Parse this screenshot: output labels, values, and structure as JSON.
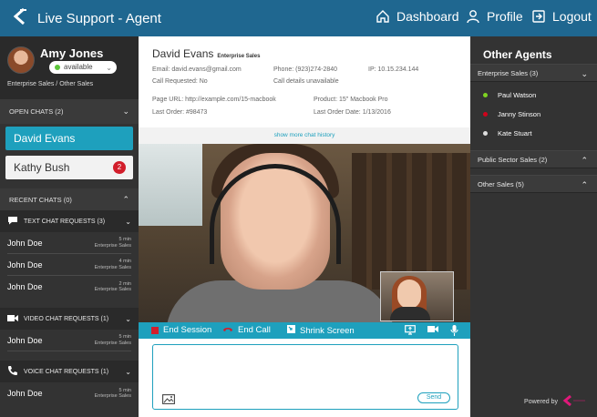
{
  "app": {
    "title": "Live Support - Agent"
  },
  "nav": {
    "dashboard": "Dashboard",
    "profile": "Profile",
    "logout": "Logout"
  },
  "agent": {
    "name": "Amy Jones",
    "status": "available",
    "team": "Enterprise Sales / Other Sales"
  },
  "open_chats": {
    "header": "OPEN CHATS (2)",
    "items": [
      {
        "name": "David Evans",
        "badge": ""
      },
      {
        "name": "Kathy Bush",
        "badge": "2"
      }
    ]
  },
  "recent_chats": {
    "header": "RECENT CHATS (0)"
  },
  "text_requests": {
    "header": "TEXT CHAT REQUESTS (3)",
    "items": [
      {
        "name": "John Doe",
        "time": "5 min",
        "team": "Enterprise Sales"
      },
      {
        "name": "John Doe",
        "time": "4 min",
        "team": "Enterprise Sales"
      },
      {
        "name": "John Doe",
        "time": "2 min",
        "team": "Enterprise Sales"
      }
    ]
  },
  "video_requests": {
    "header": "VIDEO CHAT REQUESTS (1)",
    "items": [
      {
        "name": "John Doe",
        "time": "5 min",
        "team": "Enterprise Sales"
      }
    ]
  },
  "voice_requests": {
    "header": "VOICE CHAT REQUESTS (1)",
    "items": [
      {
        "name": "John Doe",
        "time": "5 min",
        "team": "Enterprise Sales"
      }
    ]
  },
  "customer": {
    "name": "David Evans",
    "team": "Enterprise Sales",
    "email": "Email:  david.evans@gmail.com",
    "phone": "Phone:  (923)274-2840",
    "ip": "IP:  10.15.234.144",
    "call_requested": "Call Requested:  No",
    "call_details": "Call details unavailable",
    "page_url": "Page URL:  http://example.com/15-macbook",
    "product": "Product:  15\" Macbook Pro",
    "last_order": "Last Order:  #98473",
    "last_order_date": "Last Order Date:  1/13/2016"
  },
  "history_link": "show more chat history",
  "controls": {
    "end_session": "End Session",
    "end_call": "End Call",
    "shrink_screen": "Shrink Screen"
  },
  "compose": {
    "send": "Send",
    "placeholder": ""
  },
  "other_agents": {
    "title": "Other Agents",
    "groups": [
      {
        "name": "Enterprise Sales (3)",
        "expanded": true
      },
      {
        "name": "Public Sector Sales (2)",
        "expanded": false
      },
      {
        "name": "Other Sales (5)",
        "expanded": false
      }
    ],
    "agents": [
      {
        "name": "Paul Watson",
        "status_color": "#7ed321"
      },
      {
        "name": "Janny Stinson",
        "status_color": "#d0021b"
      },
      {
        "name": "Kate Stuart",
        "status_color": "#dddddd"
      }
    ]
  },
  "powered_by": "Powered by",
  "colors": {
    "topbar": "#1f6790",
    "accent": "#1ea0bd",
    "badge": "#d21e2b"
  }
}
